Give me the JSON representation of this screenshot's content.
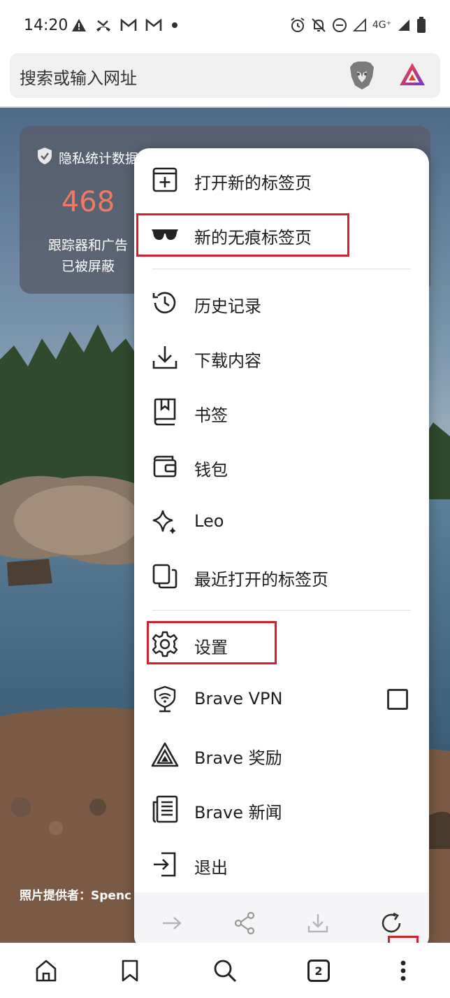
{
  "status_bar": {
    "time": "14:20",
    "network_label": "4G⁺",
    "left_icons": [
      "warning-icon",
      "missed-call-icon",
      "gmail-icon",
      "gmail-icon",
      "dot-icon"
    ],
    "right_icons": [
      "alarm-icon",
      "notifications-off-icon",
      "do-not-disturb-icon",
      "signal-icon",
      "signal-icon",
      "battery-icon"
    ]
  },
  "urlbar": {
    "placeholder": "搜索或输入网址"
  },
  "stats_card": {
    "title": "隐私统计数据",
    "trackers_count": "468",
    "trackers_label_line1": "跟踪器和广告",
    "trackers_label_line2": "已被屏蔽"
  },
  "photo_credit": "照片提供者：Spenc",
  "menu": {
    "items": [
      {
        "label": "打开新的标签页",
        "icon": "new-tab-icon"
      },
      {
        "label": "新的无痕标签页",
        "icon": "private-tab-icon"
      },
      {
        "label": "历史记录",
        "icon": "history-icon"
      },
      {
        "label": "下载内容",
        "icon": "download-icon"
      },
      {
        "label": "书签",
        "icon": "bookmarks-icon"
      },
      {
        "label": "钱包",
        "icon": "wallet-icon"
      },
      {
        "label": "Leo",
        "icon": "leo-icon"
      },
      {
        "label": "最近打开的标签页",
        "icon": "recent-tabs-icon"
      },
      {
        "label": "设置",
        "icon": "settings-icon"
      },
      {
        "label": "Brave VPN",
        "icon": "vpn-icon",
        "checked": false
      },
      {
        "label": "Brave 奖励",
        "icon": "rewards-icon"
      },
      {
        "label": "Brave 新闻",
        "icon": "news-icon"
      },
      {
        "label": "退出",
        "icon": "exit-icon"
      }
    ],
    "footer": [
      "forward-icon",
      "share-icon",
      "download-icon",
      "reload-icon"
    ]
  },
  "bottom_bar": {
    "tab_count": "2",
    "buttons": [
      "home-icon",
      "bookmark-icon",
      "search-icon",
      "tabs-icon",
      "more-icon"
    ]
  },
  "colors": {
    "highlight": "#d3202f",
    "stat_number": "#f07961",
    "card_bg": "#585e6c"
  }
}
